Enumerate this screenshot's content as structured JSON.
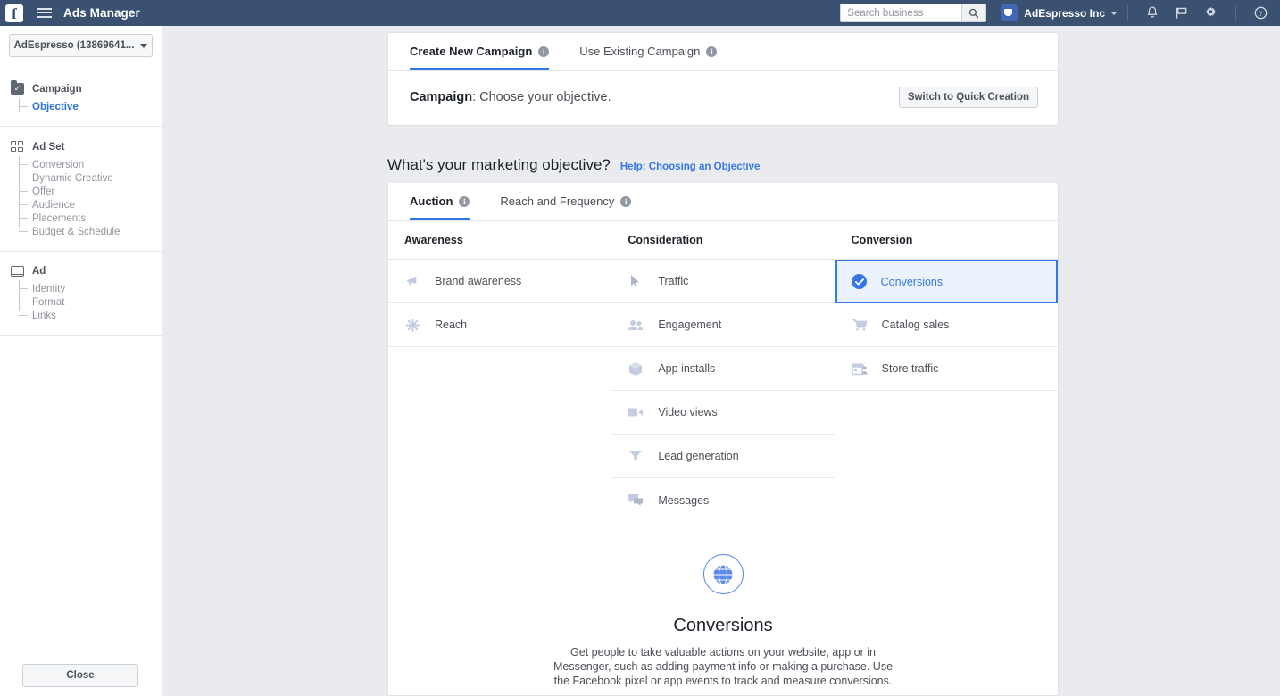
{
  "topbar": {
    "app_title": "Ads Manager",
    "logo": "facebook-logo",
    "search": {
      "placeholder": "Search business",
      "value": ""
    },
    "account_name": "AdEspresso Inc",
    "icons": [
      "search-icon",
      "bell-icon",
      "flag-icon",
      "gear-icon",
      "help-icon"
    ]
  },
  "sidebar": {
    "account_selector": "AdEspresso (13869641...",
    "sections": [
      {
        "label": "Campaign",
        "icon": "campaign-icon",
        "items": [
          {
            "label": "Objective",
            "active": true
          }
        ]
      },
      {
        "label": "Ad Set",
        "icon": "adset-grid-icon",
        "items": [
          {
            "label": "Conversion",
            "active": false
          },
          {
            "label": "Dynamic Creative",
            "active": false
          },
          {
            "label": "Offer",
            "active": false
          },
          {
            "label": "Audience",
            "active": false
          },
          {
            "label": "Placements",
            "active": false
          },
          {
            "label": "Budget & Schedule",
            "active": false
          }
        ]
      },
      {
        "label": "Ad",
        "icon": "ad-screen-icon",
        "items": [
          {
            "label": "Identity",
            "active": false
          },
          {
            "label": "Format",
            "active": false
          },
          {
            "label": "Links",
            "active": false
          }
        ]
      }
    ],
    "close_label": "Close"
  },
  "campaign_panel": {
    "tabs": [
      {
        "label": "Create New Campaign",
        "active": true,
        "info": true
      },
      {
        "label": "Use Existing Campaign",
        "active": false,
        "info": true
      }
    ],
    "campaign_prefix": "Campaign",
    "campaign_text": ": Choose your objective.",
    "quick_creation_label": "Switch to Quick Creation"
  },
  "objective_section": {
    "heading": "What's your marketing objective?",
    "help_link": "Help: Choosing an Objective",
    "tabs": [
      {
        "label": "Auction",
        "active": true,
        "info": true
      },
      {
        "label": "Reach and Frequency",
        "active": false,
        "info": true
      }
    ],
    "columns": [
      {
        "header": "Awareness",
        "items": [
          {
            "label": "Brand awareness",
            "icon": "megaphone-icon",
            "selected": false
          },
          {
            "label": "Reach",
            "icon": "reach-star-icon",
            "selected": false
          }
        ]
      },
      {
        "header": "Consideration",
        "items": [
          {
            "label": "Traffic",
            "icon": "cursor-icon",
            "selected": false
          },
          {
            "label": "Engagement",
            "icon": "people-icon",
            "selected": false
          },
          {
            "label": "App installs",
            "icon": "box-icon",
            "selected": false
          },
          {
            "label": "Video views",
            "icon": "video-camera-icon",
            "selected": false
          },
          {
            "label": "Lead generation",
            "icon": "funnel-icon",
            "selected": false
          },
          {
            "label": "Messages",
            "icon": "chat-bubbles-icon",
            "selected": false
          }
        ]
      },
      {
        "header": "Conversion",
        "items": [
          {
            "label": "Conversions",
            "icon": "check-circle-icon",
            "selected": true
          },
          {
            "label": "Catalog sales",
            "icon": "shopping-cart-icon",
            "selected": false
          },
          {
            "label": "Store traffic",
            "icon": "storefront-icon",
            "selected": false
          }
        ]
      }
    ],
    "detail": {
      "icon": "globe-icon",
      "title": "Conversions",
      "description": "Get people to take valuable actions on your website, app or in Messenger, such as adding payment info or making a purchase. Use the Facebook pixel or app events to track and measure conversions."
    }
  },
  "colors": {
    "topbar_bg": "#3b5172",
    "page_bg": "#e9ebee",
    "accent_blue": "#3578e5",
    "selected_bg": "#ebf2fc",
    "muted_text": "#90949c"
  }
}
